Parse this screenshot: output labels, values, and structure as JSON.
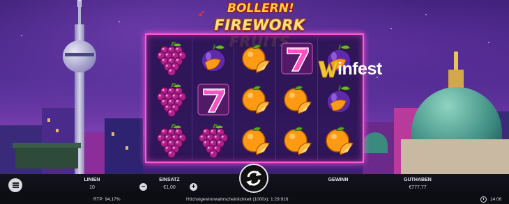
{
  "game": {
    "title_top": "BOLLERN!",
    "title_main": "FIREWORK FRUITS"
  },
  "watermark": {
    "text": "infest",
    "mark": "winfest-w-logo-icon"
  },
  "reels": {
    "rows": [
      [
        "grapes",
        "plum",
        "orange",
        "seven",
        "plum"
      ],
      [
        "grapes",
        "seven",
        "orange",
        "orange",
        "plum"
      ],
      [
        "grapes",
        "grapes",
        "orange",
        "orange",
        "orange"
      ]
    ]
  },
  "controls": {
    "linien_label": "LINIEN",
    "linien_value": "10",
    "einsatz_label": "EINSATZ",
    "einsatz_value": "€1,00",
    "gewinn_label": "GEWINN",
    "guthaben_label": "GUTHABEN",
    "guthaben_value": "€777,77",
    "minus": "−",
    "plus": "+"
  },
  "status": {
    "rtp": "RTP: 94,17%",
    "probability": "Höchstgewinnwahrscheinlichkeit (1000x): 1:29.916",
    "time": "14:06"
  },
  "colors": {
    "reel_border": "#ff5bd0",
    "bar": "#0d0d14"
  },
  "icons": [
    "menu-icon",
    "minus-icon",
    "plus-icon",
    "spin-icon",
    "clock-icon"
  ]
}
